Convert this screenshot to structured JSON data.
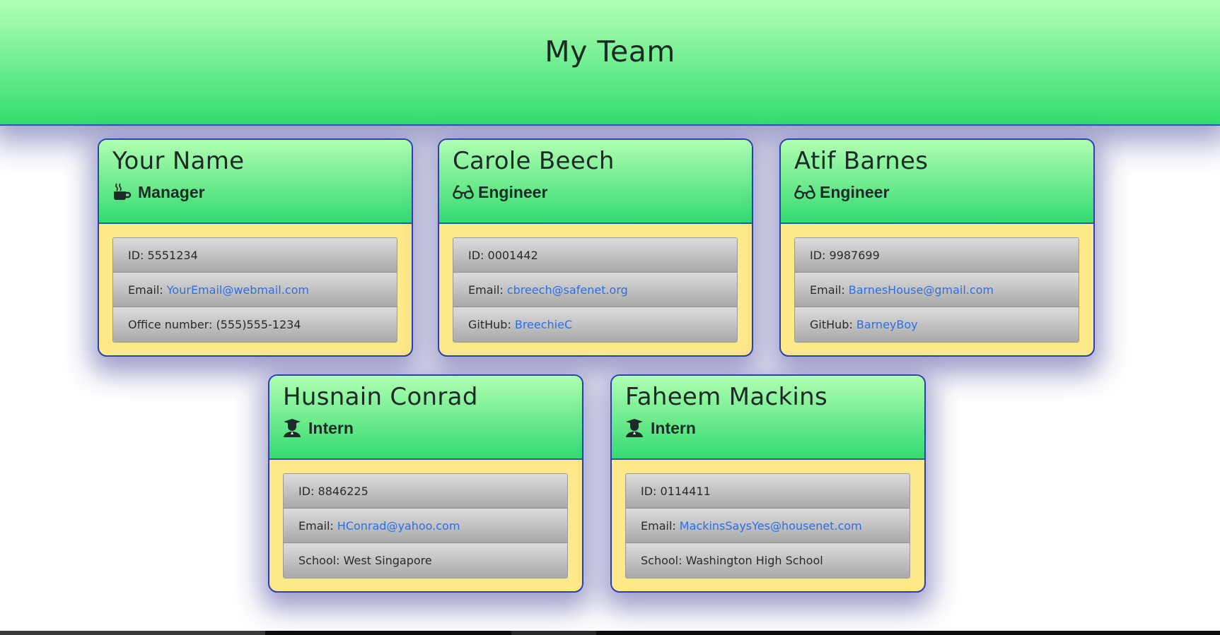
{
  "header": {
    "title": "My Team"
  },
  "cards": [
    {
      "name": "Your Name",
      "role": "Manager",
      "icon": "coffee-icon",
      "id_label": "ID: 5551234",
      "email_prefix": "Email:",
      "email": "YourEmail@webmail.com",
      "extra_prefix": "Office number:",
      "extra_value": "(555)555-1234",
      "extra_is_link": false
    },
    {
      "name": "Carole Beech",
      "role": "Engineer",
      "icon": "glasses-icon",
      "id_label": "ID: 0001442",
      "email_prefix": "Email:",
      "email": "cbreech@safenet.org",
      "extra_prefix": "GitHub:",
      "extra_value": "BreechieC",
      "extra_is_link": true
    },
    {
      "name": "Atif Barnes",
      "role": "Engineer",
      "icon": "glasses-icon",
      "id_label": "ID: 9987699",
      "email_prefix": "Email:",
      "email": "BarnesHouse@gmail.com",
      "extra_prefix": "GitHub:",
      "extra_value": "BarneyBoy",
      "extra_is_link": true
    },
    {
      "name": "Husnain Conrad",
      "role": "Intern",
      "icon": "graduate-icon",
      "id_label": "ID: 8846225",
      "email_prefix": "Email:",
      "email": "HConrad@yahoo.com",
      "extra_prefix": "School:",
      "extra_value": "West Singapore",
      "extra_is_link": false
    },
    {
      "name": "Faheem Mackins",
      "role": "Intern",
      "icon": "graduate-icon",
      "id_label": "ID: 0114411",
      "email_prefix": "Email:",
      "email": "MackinsSaysYes@housenet.com",
      "extra_prefix": "School:",
      "extra_value": "Washington High School",
      "extra_is_link": false
    }
  ],
  "colors": {
    "header_gradient_top": "#b2ffb4",
    "header_gradient_bottom": "#32dd6f",
    "card_body": "#fde98a",
    "card_border": "#2e3fb4",
    "link": "#2b6fe8"
  }
}
